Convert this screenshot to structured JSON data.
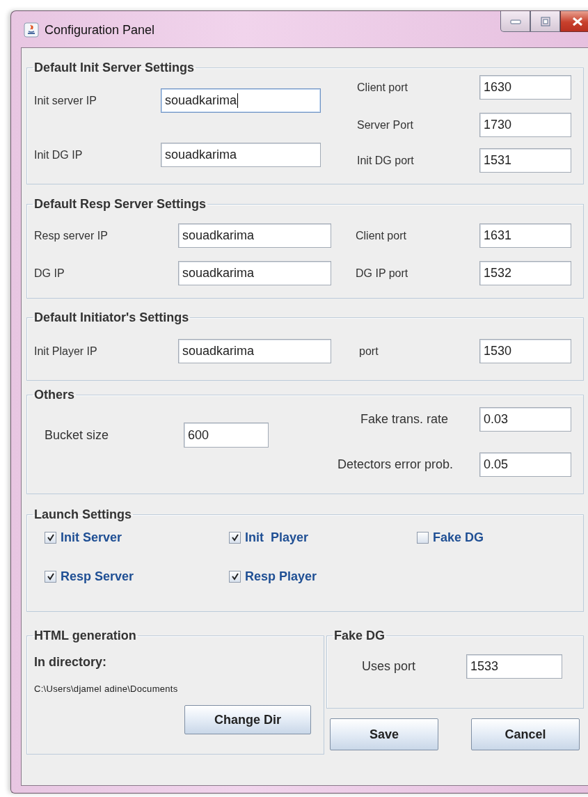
{
  "window": {
    "title": "Configuration Panel"
  },
  "init_server": {
    "title": "Default Init Server Settings",
    "fields": [
      {
        "label": "Client port",
        "value": "1630",
        "focused": false
      },
      {
        "label": "Init server IP",
        "value": "souadkarima",
        "focused": true
      },
      {
        "label": "Server Port",
        "value": "1730",
        "focused": false
      },
      {
        "label": "Init DG IP",
        "value": "souadkarima",
        "focused": false
      },
      {
        "label": "Init DG port",
        "value": "1531",
        "focused": false
      }
    ]
  },
  "resp_server": {
    "title": "Default Resp Server Settings",
    "fields": [
      {
        "label": "Resp server IP",
        "value": "souadkarima",
        "focused": false
      },
      {
        "label": "Client port",
        "value": "1631",
        "focused": false
      },
      {
        "label": "DG IP",
        "value": "souadkarima",
        "focused": false
      },
      {
        "label": "DG IP port",
        "value": "1532",
        "focused": false
      }
    ]
  },
  "initiator": {
    "title": "Default Initiator's Settings",
    "fields": [
      {
        "label": "Init Player IP",
        "value": "souadkarima",
        "focused": false
      },
      {
        "label": "port",
        "value": "1530",
        "focused": false
      }
    ]
  },
  "others": {
    "title": "Others",
    "fields": [
      {
        "label": "Bucket size",
        "value": "600",
        "focused": false
      },
      {
        "label": "Fake trans. rate",
        "value": "0.03",
        "focused": false
      },
      {
        "label": "Detectors error prob.",
        "value": "0.05",
        "focused": false
      }
    ]
  },
  "launch": {
    "title": "Launch Settings",
    "options": [
      {
        "label": "Init Server",
        "checked": true
      },
      {
        "label": "Init  Player",
        "checked": true
      },
      {
        "label": "Fake DG",
        "checked": false
      },
      {
        "label": "Resp Server",
        "checked": true
      },
      {
        "label": "Resp Player",
        "checked": true
      }
    ]
  },
  "html_generation": {
    "title": "HTML generation",
    "heading": "In directory:",
    "path": "C:\\Users\\djamel adine\\Documents",
    "button": "Change Dir"
  },
  "fake_dg": {
    "title": "Fake DG",
    "fields": [
      {
        "label": "Uses port",
        "value": "1533",
        "focused": false
      }
    ]
  },
  "buttons": [
    "Save",
    "Cancel"
  ]
}
